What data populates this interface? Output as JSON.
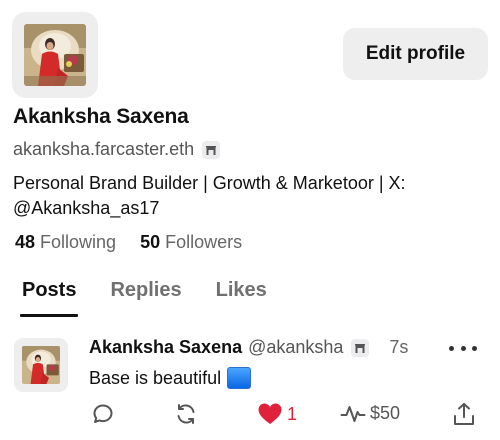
{
  "profile": {
    "display_name": "Akanksha Saxena",
    "username": "akanksha.farcaster.eth",
    "bio": "Personal Brand Builder | Growth & Marketoor | X: @Akanksha_as17",
    "edit_label": "Edit profile",
    "following_count": "48",
    "following_label": "Following",
    "followers_count": "50",
    "followers_label": "Followers"
  },
  "tabs": [
    {
      "label": "Posts",
      "active": true
    },
    {
      "label": "Replies",
      "active": false
    },
    {
      "label": "Likes",
      "active": false
    }
  ],
  "post": {
    "author": "Akanksha Saxena",
    "handle": "@akanksha",
    "time": "7s",
    "text": "Base is beautiful",
    "likes": "1",
    "tip": "$50"
  },
  "icons": {
    "badge": "arch-badge-icon",
    "more": "more-dots-icon",
    "reply": "comment-icon",
    "recast": "recast-icon",
    "like": "heart-icon",
    "tip": "pulse-icon",
    "share": "share-icon"
  },
  "colors": {
    "like_red": "#e0213c",
    "button_gray": "#eeeeef",
    "blue_square": "#1a73e8"
  }
}
